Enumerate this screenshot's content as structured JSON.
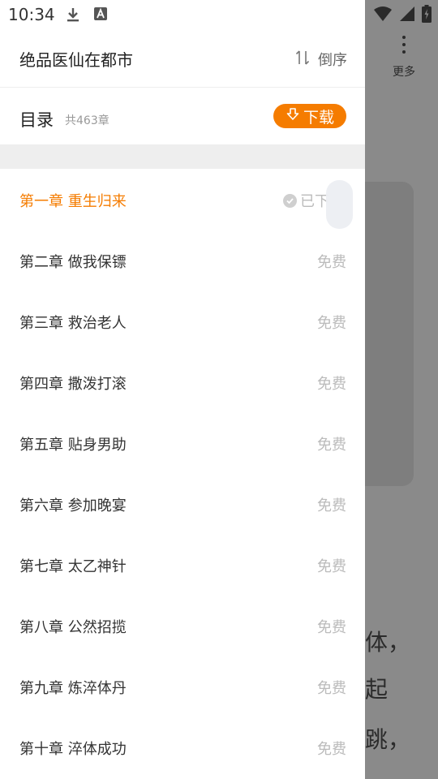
{
  "status_bar": {
    "time": "10:34"
  },
  "background": {
    "more_label": "更多",
    "text_lines": [
      "体，",
      "起",
      "跳，"
    ]
  },
  "drawer": {
    "book_title": "绝品医仙在都市",
    "sort_label": "倒序",
    "toc_title": "目录",
    "toc_count": "共463章",
    "download_label": "下载",
    "accent": "#f57c00",
    "chapters": [
      {
        "title": "第一章 重生归来",
        "status": "已下",
        "active": true
      },
      {
        "title": "第二章 做我保镖",
        "status": "免费"
      },
      {
        "title": "第三章 救治老人",
        "status": "免费"
      },
      {
        "title": "第四章 撒泼打滚",
        "status": "免费"
      },
      {
        "title": "第五章 贴身男助",
        "status": "免费"
      },
      {
        "title": "第六章 参加晚宴",
        "status": "免费"
      },
      {
        "title": "第七章 太乙神针",
        "status": "免费"
      },
      {
        "title": "第八章 公然招揽",
        "status": "免费"
      },
      {
        "title": "第九章 炼淬体丹",
        "status": "免费"
      },
      {
        "title": "第十章 淬体成功",
        "status": "免费"
      }
    ]
  }
}
